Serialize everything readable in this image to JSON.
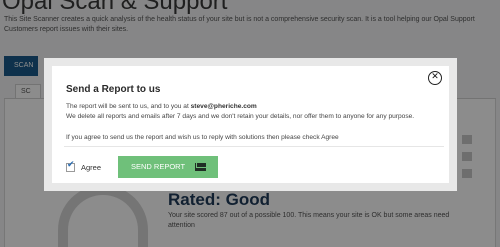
{
  "background": {
    "title": "Opal Scan & Support",
    "description": "This Site Scanner creates a quick analysis of the health status of your site but is not a comprehensive security scan. It is a tool helping our Opal Support Customers report issues with their sites.",
    "scan_button": "SCAN",
    "tab_label": "SC",
    "rated_label": "Rated: Good",
    "score_text": "Your site scored 87 out of a possible 100. This means your site is OK but some areas need attention"
  },
  "modal": {
    "title": "Send a Report to us",
    "line1_prefix": "The report will be sent to us, and to you at ",
    "email": "steve@pheriche.com",
    "line2": "We delete all reports and emails after 7 days and we don't retain your details, nor offer them to anyone for any purpose.",
    "line3": "If you agree to send us the report and wish us to reply with solutions then please check Agree",
    "agree_label": "Agree",
    "agree_checked": true,
    "send_label": "SEND REPORT",
    "close_icon": "close-icon",
    "send_icon": "envelope-icon"
  }
}
